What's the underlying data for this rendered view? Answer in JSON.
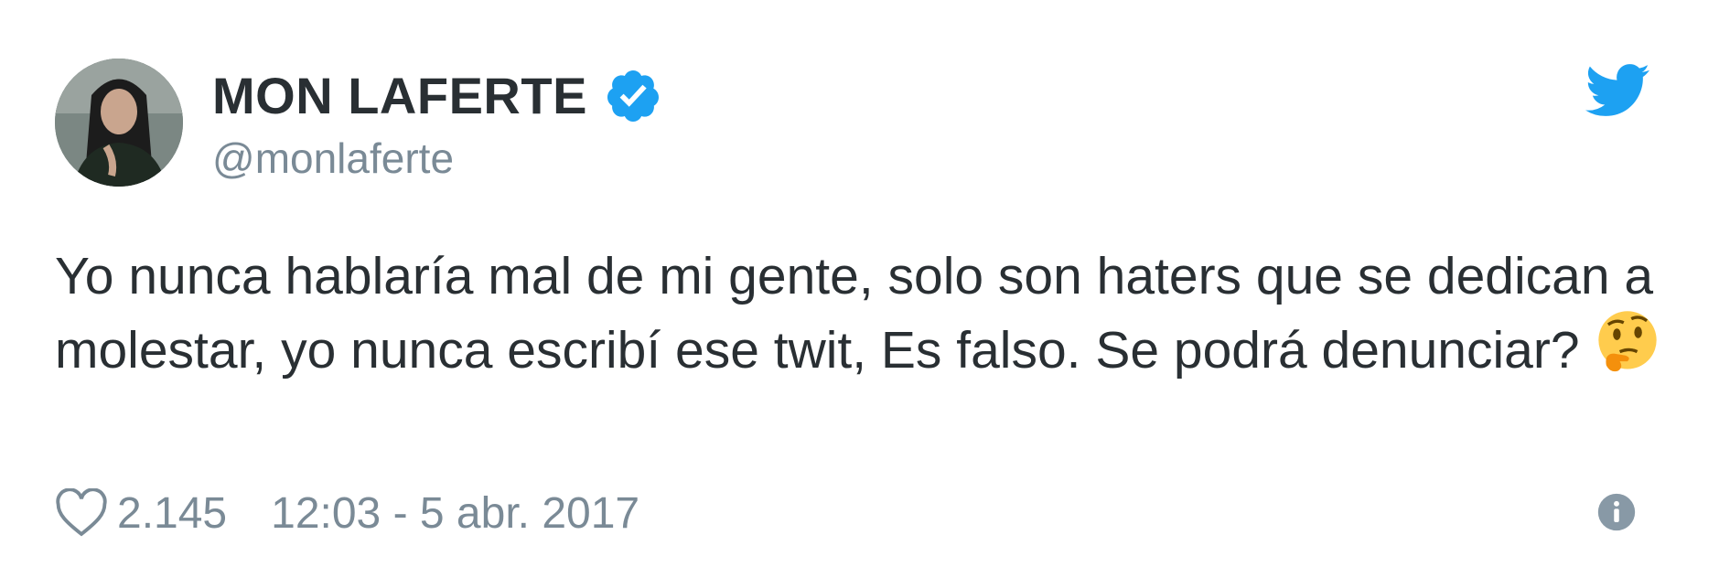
{
  "author": {
    "display_name": "MON LAFERTE",
    "handle": "@monlaferte",
    "verified": true
  },
  "tweet": {
    "text": "Yo nunca hablaría mal de mi gente, solo son haters que se dedican a molestar, yo nunca escribí ese twit, Es falso. Se podrá denunciar?",
    "emoji": "thinking-face"
  },
  "footer": {
    "likes": "2.145",
    "timestamp": "12:03 - 5 abr. 2017"
  },
  "icons": {
    "brand": "twitter-bird-icon",
    "like": "heart-icon",
    "info": "info-icon"
  },
  "colors": {
    "twitter_blue": "#1da1f2",
    "muted_text": "#7a8a96",
    "body_text": "#292f33"
  }
}
